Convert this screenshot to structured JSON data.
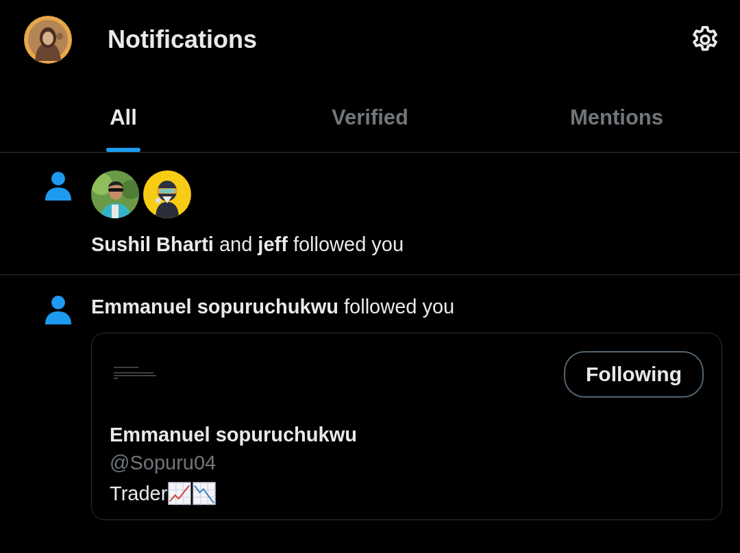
{
  "header": {
    "title": "Notifications"
  },
  "tabs": [
    {
      "label": "All",
      "selected": true
    },
    {
      "label": "Verified",
      "selected": false
    },
    {
      "label": "Mentions",
      "selected": false
    }
  ],
  "notifications": [
    {
      "kind": "group",
      "text": "**Sushil Bharti** and **jeff** followed you"
    },
    {
      "kind": "card",
      "text": "**Emmanuel sopuruchukwu** followed you",
      "card": {
        "button": "Following",
        "name": "Emmanuel sopuruchukwu",
        "handle": "@Sopuru04",
        "bio": "Trader"
      }
    }
  ]
}
